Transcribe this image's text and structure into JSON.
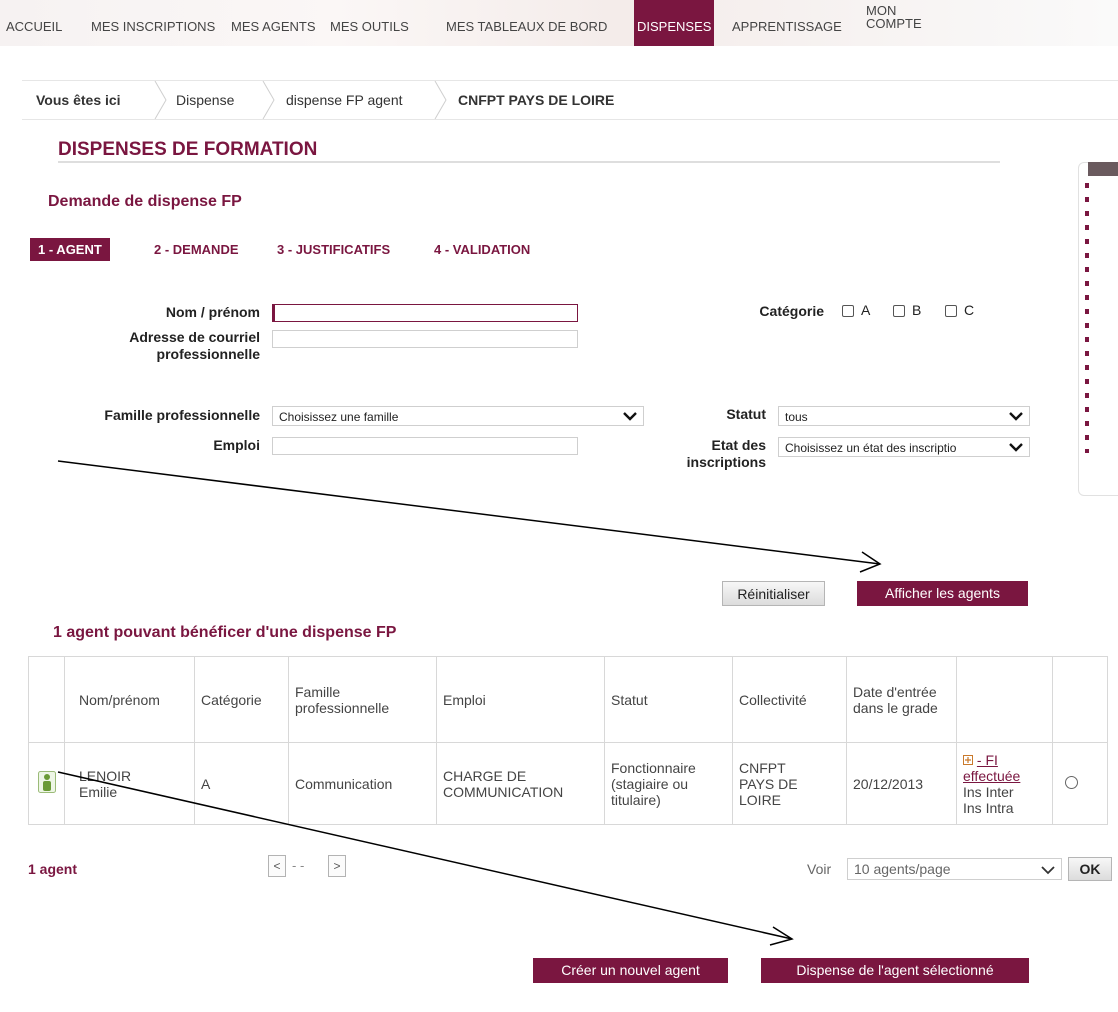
{
  "nav": {
    "items": [
      {
        "label": "ACCUEIL"
      },
      {
        "label": "MES INSCRIPTIONS"
      },
      {
        "label": "MES AGENTS"
      },
      {
        "label": "MES OUTILS"
      },
      {
        "label": "MES TABLEAUX DE BORD"
      },
      {
        "label": "DISPENSES"
      },
      {
        "label": "APPRENTISSAGE"
      },
      {
        "label_line1": "MON",
        "label_line2": "COMPTE"
      }
    ]
  },
  "breadcrumb": {
    "intro": "Vous êtes ici",
    "items": [
      {
        "label": "Dispense"
      },
      {
        "label": "dispense FP agent"
      },
      {
        "label": "CNFPT PAYS DE LOIRE"
      }
    ]
  },
  "page": {
    "title": "DISPENSES DE FORMATION",
    "subtitle": "Demande de dispense FP"
  },
  "steps": [
    {
      "label": "1 - AGENT"
    },
    {
      "label": "2 - DEMANDE"
    },
    {
      "label": "3 - JUSTIFICATIFS"
    },
    {
      "label": "4 - VALIDATION"
    }
  ],
  "form": {
    "nom_label": "Nom / prénom",
    "nom_value": "",
    "courriel_label_1": "Adresse de courriel",
    "courriel_label_2": "professionnelle",
    "courriel_value": "",
    "famille_label": "Famille professionnelle",
    "famille_value": "Choisissez une famille",
    "emploi_label": "Emploi",
    "emploi_value": "",
    "categorie_label": "Catégorie",
    "categorie_options": [
      "A",
      "B",
      "C"
    ],
    "statut_label": "Statut",
    "statut_value": "tous",
    "etat_label_1": "Etat des",
    "etat_label_2": "inscriptions",
    "etat_value": "Choisissez un état des inscriptio"
  },
  "buttons": {
    "reset": "Réinitialiser",
    "show_agents": "Afficher les agents",
    "create_agent": "Créer un nouvel agent",
    "dispense_selected": "Dispense de l'agent sélectionné"
  },
  "results": {
    "title": "1 agent pouvant bénéficer d'une dispense FP",
    "columns": [
      "Nom/prénom",
      "Catégorie",
      "Famille professionnelle",
      "Emploi",
      "Statut",
      "Collectivité",
      "Date d'entrée dans le grade"
    ],
    "rows": [
      {
        "nom": "LENOIR",
        "prenom": "Emilie",
        "categorie": "A",
        "famille": "Communication",
        "emploi_1": "CHARGE DE",
        "emploi_2": "COMMUNICATION",
        "statut_1": "Fonctionnaire",
        "statut_2": "(stagiaire ou",
        "statut_3": "titulaire)",
        "collectivite_1": "CNFPT",
        "collectivite_2": "PAYS DE",
        "collectivite_3": "LOIRE",
        "date": "20/12/2013",
        "fi_1": "- FI",
        "fi_2": "effectuée",
        "ins_inter": "Ins Inter",
        "ins_intra": "Ins Intra"
      }
    ]
  },
  "pagination": {
    "count": "1 agent",
    "prev": "<",
    "dashes": "- -",
    "next": ">",
    "voir_label": "Voir",
    "per_page_value": "10 agents/page",
    "ok": "OK"
  },
  "colors": {
    "brand": "#7a1640"
  }
}
